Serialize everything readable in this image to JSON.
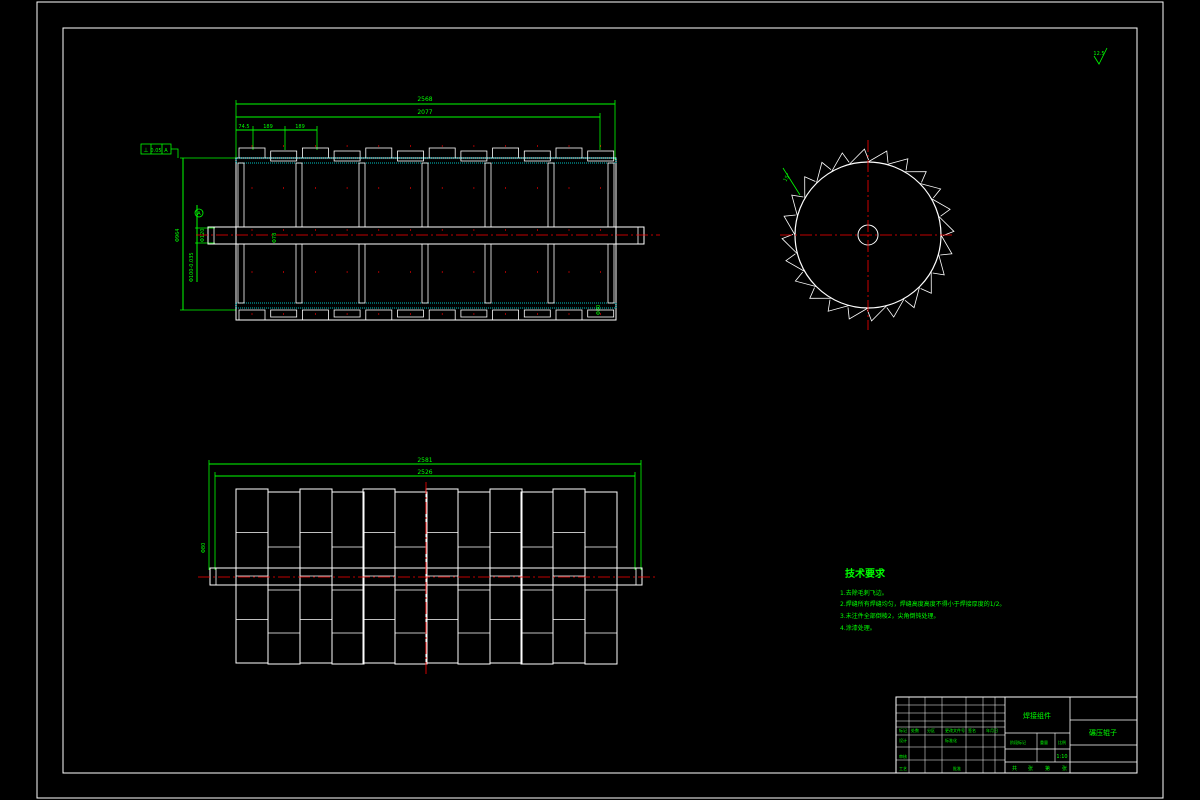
{
  "drawing": {
    "top_view": {
      "overall_length": "2568",
      "inner_length": "2077",
      "dim_a": "74.5",
      "dim_b": "189",
      "dim_c": "189",
      "dim_left_tall": "Φ964",
      "dim_left_shaft": "Φ100-0.035",
      "dim_shaft_small": "Φ120",
      "dim_shaft_mid": "Φ78",
      "datum_label": "A",
      "tolerance_frame": [
        "⊥",
        "0.05",
        "A"
      ],
      "dim_right_small": "Φ80"
    },
    "side_view": {
      "angle_label": "15°"
    },
    "bottom_view": {
      "overall_length": "2581",
      "inner_length": "2526",
      "side_dim": "Φ80"
    },
    "roughness_symbol": "12.5",
    "tech_requirements": {
      "title": "技术要求",
      "items": [
        "1.去除毛刺飞边。",
        "2.焊缝所有焊缝均匀，焊缝高度高度不得小于焊接厚度的1/2。",
        "3.未注件全部倒棱2，尖角倒钝处理。",
        "4.涂漆处理。"
      ]
    },
    "title_block": {
      "material_label": "焊接组件",
      "part_name": "碾压辊子",
      "scale": "1:10",
      "bottom_labels": [
        "共",
        "张",
        "第",
        "张"
      ],
      "row_labels": [
        "标记",
        "处数",
        "分区",
        "更改文件号",
        "签名",
        "年月日",
        "设计",
        "审核",
        "工艺",
        "标准化",
        "批准",
        "阶段标记",
        "重量",
        "比例"
      ]
    }
  }
}
